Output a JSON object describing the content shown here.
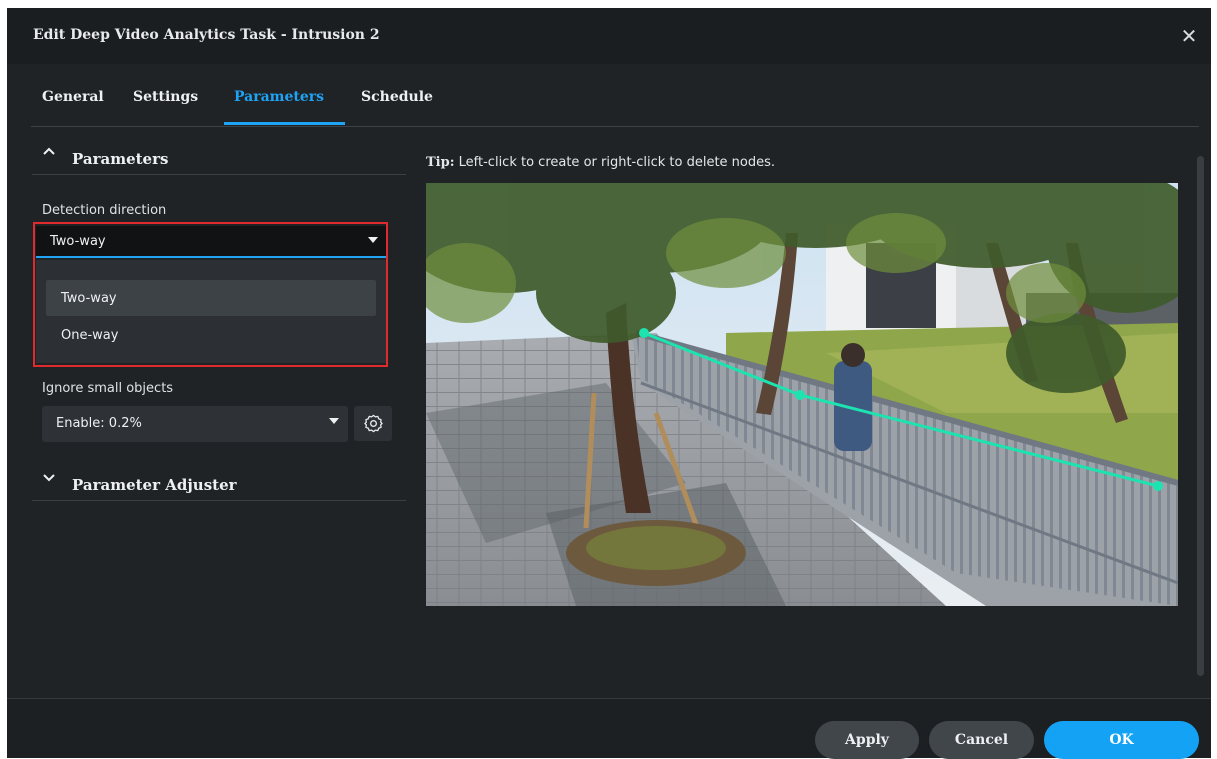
{
  "dialog": {
    "title": "Edit Deep Video Analytics Task - Intrusion 2",
    "close_glyph": "✕"
  },
  "tabs": [
    {
      "label": "General",
      "active": false
    },
    {
      "label": "Settings",
      "active": false
    },
    {
      "label": "Parameters",
      "active": true
    },
    {
      "label": "Schedule",
      "active": false
    }
  ],
  "parameters_section": {
    "title": "Parameters",
    "expanded": true,
    "detection_direction": {
      "label": "Detection direction",
      "value": "Two-way",
      "options": [
        "Two-way",
        "One-way"
      ]
    },
    "ignore_small_objects": {
      "label": "Ignore small objects",
      "value": "Enable: 0.2%"
    }
  },
  "adjuster_section": {
    "title": "Parameter Adjuster",
    "expanded": false
  },
  "tip": {
    "prefix": "Tip:",
    "text": "Left-click to create or right-click to delete nodes."
  },
  "footer": {
    "apply": "Apply",
    "cancel": "Cancel",
    "ok": "OK"
  },
  "colors": {
    "accent": "#1fa3f5",
    "highlight_border": "#e02a2e",
    "detection_line": "#1de3b0"
  },
  "icons": [
    "close-icon",
    "chevron-up-icon",
    "chevron-down-icon",
    "caret-down-icon",
    "gear-icon"
  ]
}
